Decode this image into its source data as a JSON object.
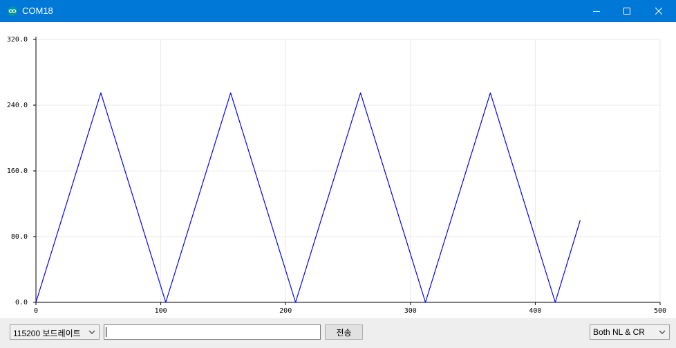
{
  "window": {
    "title": "COM18",
    "icon": "arduino-icon",
    "controls": [
      "minimize-icon",
      "maximize-icon",
      "close-icon"
    ]
  },
  "chart_data": {
    "type": "line",
    "title": "",
    "xlabel": "",
    "ylabel": "",
    "xlim": [
      0,
      500
    ],
    "ylim": [
      0,
      320
    ],
    "x_ticks": [
      "0",
      "100",
      "200",
      "300",
      "400",
      "500"
    ],
    "y_ticks": [
      "0.0",
      "80.0",
      "160.0",
      "240.0",
      "320.0"
    ],
    "grid": true,
    "series": [
      {
        "color": "#0000ff",
        "x": [
          0,
          52,
          104,
          156,
          208,
          260,
          312,
          364,
          416,
          436
        ],
        "y": [
          0,
          255,
          0,
          255,
          0,
          255,
          0,
          255,
          0,
          100
        ]
      }
    ]
  },
  "controls": {
    "baud_label": "115200 보드레이트",
    "message_value": "",
    "send_label": "전송",
    "line_ending_label": "Both NL & CR"
  }
}
